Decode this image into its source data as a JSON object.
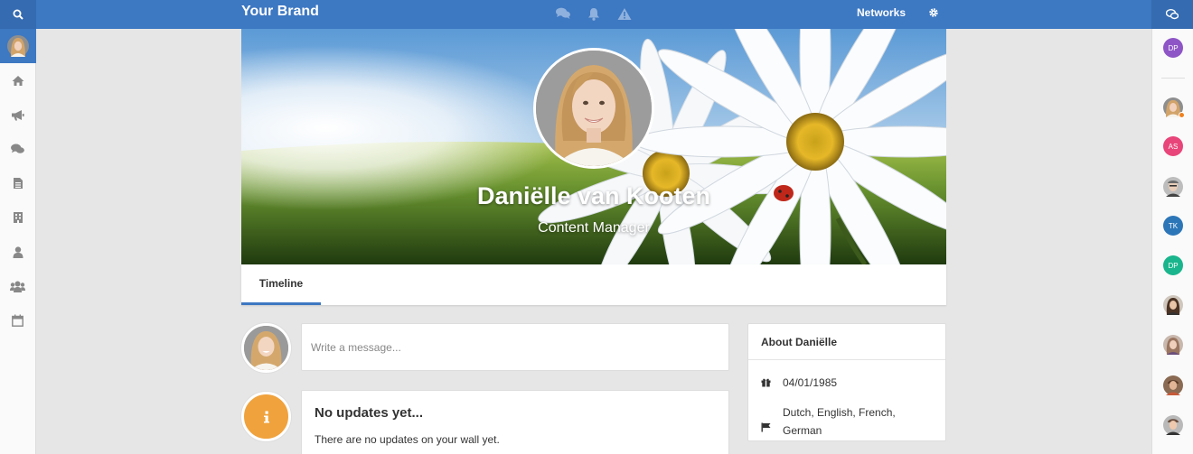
{
  "topbar": {
    "brand": "Your Brand",
    "networks_label": "Networks",
    "icons": [
      "search-icon",
      "comments-icon",
      "bell-icon",
      "warning-icon",
      "gear-icon",
      "chat-icon"
    ]
  },
  "left_nav": [
    "home-icon",
    "megaphone-icon",
    "comments-icon",
    "document-icon",
    "building-icon",
    "user-icon",
    "users-icon",
    "calendar-icon"
  ],
  "profile": {
    "name": "Daniëlle van Kooten",
    "role": "Content Manager"
  },
  "tabs": [
    {
      "label": "Timeline"
    }
  ],
  "composer": {
    "placeholder": "Write a message..."
  },
  "updates": {
    "title": "No updates yet...",
    "text": "There are no updates on your wall yet."
  },
  "about": {
    "title": "About Daniëlle",
    "birthday": "04/01/1985",
    "languages_line1": "Dutch, English, French,",
    "languages_line2": "German"
  },
  "contacts": [
    {
      "initials": "DP",
      "color": "#8e55c6"
    },
    {
      "initials": "",
      "color": "#b99876",
      "status": "online"
    },
    {
      "initials": "AS",
      "color": "#e8457a"
    },
    {
      "initials": "",
      "color": "#9d9d9d"
    },
    {
      "initials": "TK",
      "color": "#2c76b8"
    },
    {
      "initials": "DP",
      "color": "#1ab58c"
    },
    {
      "initials": "",
      "color": "#7a5a48"
    },
    {
      "initials": "",
      "color": "#a38879"
    },
    {
      "initials": "",
      "color": "#8a6a52"
    },
    {
      "initials": "",
      "color": "#8b8b8b"
    }
  ],
  "colors": {
    "primary": "#3d78c2",
    "accent": "#f0a23c"
  }
}
